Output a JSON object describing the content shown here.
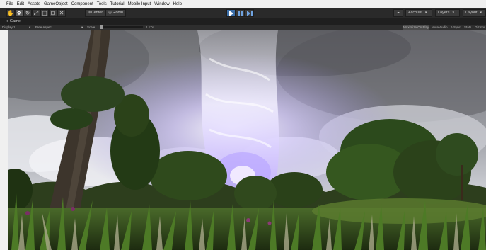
{
  "menu": [
    "File",
    "Edit",
    "Assets",
    "GameObject",
    "Component",
    "Tools",
    "Tutorial",
    "Mobile Input",
    "Window",
    "Help"
  ],
  "toolbar": {
    "tool_icons": [
      "hand-icon",
      "move-icon",
      "rotate-icon",
      "scale-icon",
      "rect-icon",
      "transform-icon",
      "custom-tool-icon"
    ],
    "pivot_label": "Center",
    "space_label": "Global",
    "play_icons": [
      "play-icon",
      "pause-icon",
      "step-icon"
    ],
    "account_label": "Account",
    "layers_label": "Layers",
    "layout_label": "Layout"
  },
  "game_tab": {
    "label": "Game"
  },
  "game_bar": {
    "display": "Display 1",
    "aspect": "Free Aspect",
    "scale_label": "Scale",
    "scale_value": "1.17x",
    "maximize": "Maximize On Play",
    "mute": "Mute Audio",
    "vsync": "VSync",
    "stats": "Stats",
    "gizmos": "Gizmos"
  }
}
